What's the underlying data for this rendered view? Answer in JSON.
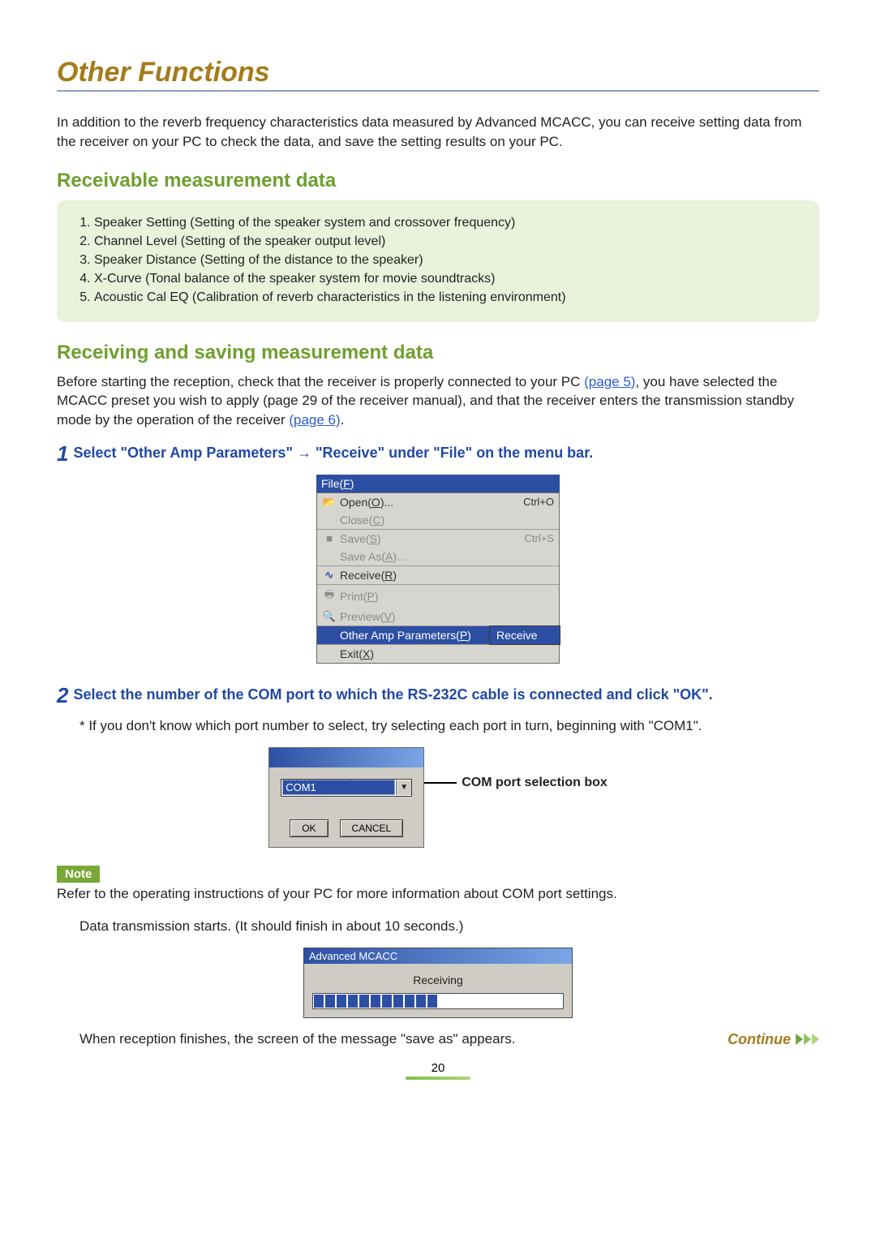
{
  "title": "Other Functions",
  "intro": "In addition to the reverb frequency characteristics data measured by Advanced MCACC, you can receive setting data from the receiver on your PC to check the data, and save the setting results on your PC.",
  "section1_heading": "Receivable measurement data",
  "receivable_list": [
    "Speaker Setting (Setting of the speaker system and crossover frequency)",
    "Channel Level (Setting of the speaker output level)",
    "Speaker Distance (Setting of the distance to the speaker)",
    "X-Curve (Tonal balance of the speaker system for movie soundtracks)",
    "Acoustic Cal EQ (Calibration of reverb characteristics in the listening environment)"
  ],
  "section2_heading": "Receiving and saving measurement data",
  "section2_para_a": "Before starting the reception, check that the receiver is properly connected to your PC ",
  "link_page5": "(page 5)",
  "section2_para_b": ", you have selected the MCACC preset you wish to apply (page 29 of the receiver manual), and that the receiver enters the transmission standby mode by the operation of the receiver ",
  "link_page6": "(page 6)",
  "section2_para_c": ".",
  "step1_num": "1",
  "step1_a": "Select \"Other Amp Parameters\" ",
  "step1_arrow": "→",
  "step1_b": " \"Receive\" under \"File\" on the menu bar.",
  "file_menu": {
    "title_pre": "File(",
    "title_u": "F",
    "title_post": ")",
    "open": {
      "icon": "📂",
      "pre": "Open(",
      "u": "O",
      "post": ")...",
      "sc": "Ctrl+O"
    },
    "close": {
      "icon": "",
      "pre": "Close(",
      "u": "C",
      "post": ")",
      "sc": ""
    },
    "save": {
      "icon": "■",
      "pre": "Save(",
      "u": "S",
      "post": ")",
      "sc": "Ctrl+S"
    },
    "saveas": {
      "icon": "",
      "pre": "Save As(",
      "u": "A",
      "post": ")...",
      "sc": ""
    },
    "receive": {
      "icon": "∿",
      "pre": "Receive(",
      "u": "R",
      "post": ")",
      "sc": ""
    },
    "print": {
      "icon": "🖶",
      "pre": "Print(",
      "u": "P",
      "post": ")",
      "sc": ""
    },
    "preview": {
      "icon": "🔍",
      "pre": "Preview(",
      "u": "V",
      "post": ")",
      "sc": ""
    },
    "other": {
      "icon": "",
      "pre": "Other Amp Parameters(",
      "u": "P",
      "post": ")",
      "sc": ""
    },
    "exit": {
      "icon": "",
      "pre": "Exit(",
      "u": "X",
      "post": ")",
      "sc": ""
    },
    "submenu": "Receive"
  },
  "step2_num": "2",
  "step2_text": "Select the number of the COM port to which the RS-232C cable is connected and click \"OK\".",
  "step2_hint": "* If you don't know which port number to select, try selecting each port in turn, beginning with \"COM1\".",
  "com_dialog": {
    "value": "COM1",
    "ok": "OK",
    "cancel": "CANCEL"
  },
  "com_label": "COM port selection box",
  "note_label": "Note",
  "note_text": "Refer to the operating instructions of your PC for more information about COM port settings.",
  "transmission_text": "Data transmission starts. (It should finish in about 10 seconds.)",
  "progress": {
    "title": "Advanced MCACC",
    "status": "Receiving"
  },
  "finish_text": "When reception finishes, the screen of the message \"save as\" appears.",
  "continue_text": "Continue",
  "page_number": "20"
}
